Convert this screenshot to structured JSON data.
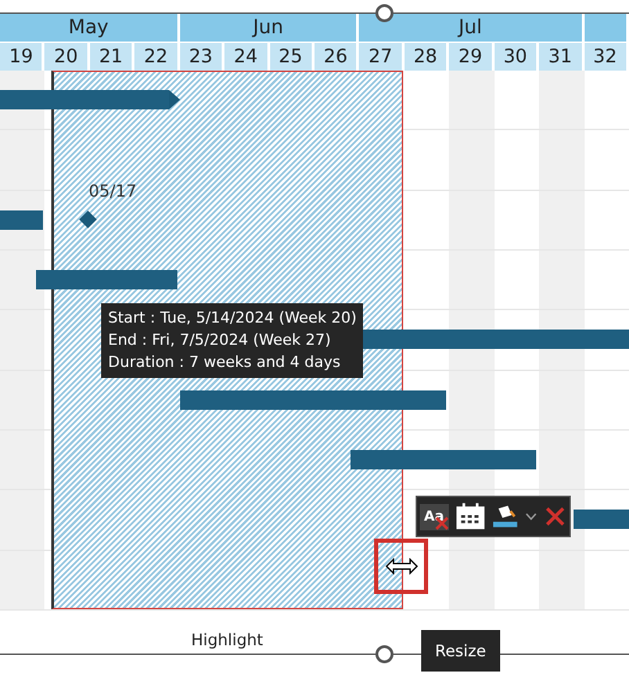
{
  "months": [
    {
      "label": "May"
    },
    {
      "label": "Jun"
    },
    {
      "label": "Jul"
    }
  ],
  "weeks": [
    {
      "label": "19",
      "shaded": true
    },
    {
      "label": "20"
    },
    {
      "label": "21"
    },
    {
      "label": "22"
    },
    {
      "label": "23"
    },
    {
      "label": "24"
    },
    {
      "label": "25"
    },
    {
      "label": "26"
    },
    {
      "label": "27",
      "shaded": false
    },
    {
      "label": "28",
      "shaded": false
    },
    {
      "label": "29",
      "shaded": true
    },
    {
      "label": "30",
      "shaded": false
    },
    {
      "label": "31",
      "shaded": true
    },
    {
      "label": "32",
      "shaded": false
    }
  ],
  "milestone": {
    "label": "05/17"
  },
  "tooltip": {
    "lines": [
      "Start : Tue, 5/14/2024 (Week 20)",
      "End : Fri, 7/5/2024 (Week 27)",
      "Duration : 7 weeks and 4 days"
    ]
  },
  "toolbar": {
    "format_label": "Aa"
  },
  "highlight_label": "Highlight",
  "resize_tip": "Resize"
}
